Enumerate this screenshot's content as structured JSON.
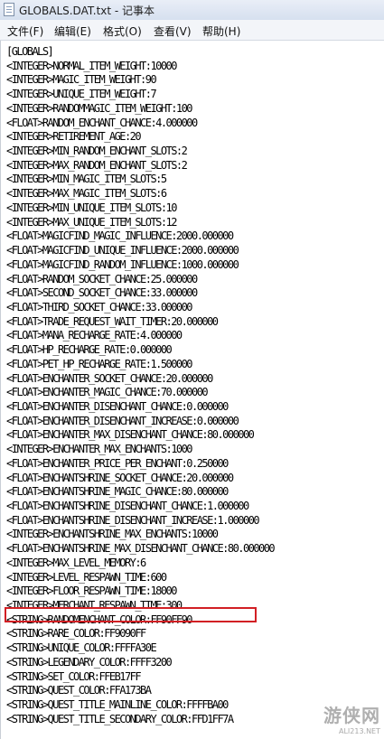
{
  "window": {
    "title": "GLOBALS.DAT.txt - 记事本"
  },
  "menu": {
    "items": [
      "文件(F)",
      "编辑(E)",
      "格式(O)",
      "查看(V)",
      "帮助(H)"
    ]
  },
  "document": {
    "lines": [
      "[GLOBALS]",
      "<INTEGER>NORMAL_ITEM_WEIGHT:10000",
      "<INTEGER>MAGIC_ITEM_WEIGHT:90",
      "<INTEGER>UNIQUE_ITEM_WEIGHT:7",
      "<INTEGER>RANDOMMAGIC_ITEM_WEIGHT:100",
      "<FLOAT>RANDOM_ENCHANT_CHANCE:4.000000",
      "<INTEGER>RETIREMENT_AGE:20",
      "<INTEGER>MIN_RANDOM_ENCHANT_SLOTS:2",
      "<INTEGER>MAX_RANDOM_ENCHANT_SLOTS:2",
      "<INTEGER>MIN_MAGIC_ITEM_SLOTS:5",
      "<INTEGER>MAX_MAGIC_ITEM_SLOTS:6",
      "<INTEGER>MIN_UNIQUE_ITEM_SLOTS:10",
      "<INTEGER>MAX_UNIQUE_ITEM_SLOTS:12",
      "<FLOAT>MAGICFIND_MAGIC_INFLUENCE:2000.000000",
      "<FLOAT>MAGICFIND_UNIQUE_INFLUENCE:2000.000000",
      "<FLOAT>MAGICFIND_RANDOM_INFLUENCE:1000.000000",
      "<FLOAT>RANDOM_SOCKET_CHANCE:25.000000",
      "<FLOAT>SECOND_SOCKET_CHANCE:33.000000",
      "<FLOAT>THIRD_SOCKET_CHANCE:33.000000",
      "<FLOAT>TRADE_REQUEST_WAIT_TIMER:20.000000",
      "<FLOAT>MANA_RECHARGE_RATE:4.000000",
      "<FLOAT>HP_RECHARGE_RATE:0.000000",
      "<FLOAT>PET_HP_RECHARGE_RATE:1.500000",
      "<FLOAT>ENCHANTER_SOCKET_CHANCE:20.000000",
      "<FLOAT>ENCHANTER_MAGIC_CHANCE:70.000000",
      "<FLOAT>ENCHANTER_DISENCHANT_CHANCE:0.000000",
      "<FLOAT>ENCHANTER_DISENCHANT_INCREASE:0.000000",
      "<FLOAT>ENCHANTER_MAX_DISENCHANT_CHANCE:80.000000",
      "<INTEGER>ENCHANTER_MAX_ENCHANTS:1000",
      "<FLOAT>ENCHANTER_PRICE_PER_ENCHANT:0.250000",
      "<FLOAT>ENCHANTSHRINE_SOCKET_CHANCE:20.000000",
      "<FLOAT>ENCHANTSHRINE_MAGIC_CHANCE:80.000000",
      "<FLOAT>ENCHANTSHRINE_DISENCHANT_CHANCE:1.000000",
      "<FLOAT>ENCHANTSHRINE_DISENCHANT_INCREASE:1.000000",
      "<INTEGER>ENCHANTSHRINE_MAX_ENCHANTS:10000",
      "<FLOAT>ENCHANTSHRINE_MAX_DISENCHANT_CHANCE:80.000000",
      "<INTEGER>MAX_LEVEL_MEMORY:6",
      "<INTEGER>LEVEL_RESPAWN_TIME:600",
      "<INTEGER>FLOOR_RESPAWN_TIME:18000",
      "<INTEGER>MERCHANT_RESPAWN_TIME:300",
      "<STRING>RANDOMENCHANT_COLOR:FF90FF90",
      "<STRING>RARE_COLOR:FF9090FF",
      "<STRING>UNIQUE_COLOR:FFFFA30E",
      "<STRING>LEGENDARY_COLOR:FFFF3200",
      "<STRING>SET_COLOR:FFEB17FF",
      "<STRING>QUEST_COLOR:FFA173BA",
      "<STRING>QUEST_TITLE_MAINLINE_COLOR:FFFFBA00",
      "<STRING>QUEST_TITLE_SECONDARY_COLOR:FFD1FF7A"
    ],
    "highlighted_line": "<INTEGER>MERCHANT_RESPAWN_TIME:300",
    "highlight_color": "#d21f24"
  },
  "watermark": {
    "logo": "游侠网",
    "url": "ALI213.NET"
  }
}
